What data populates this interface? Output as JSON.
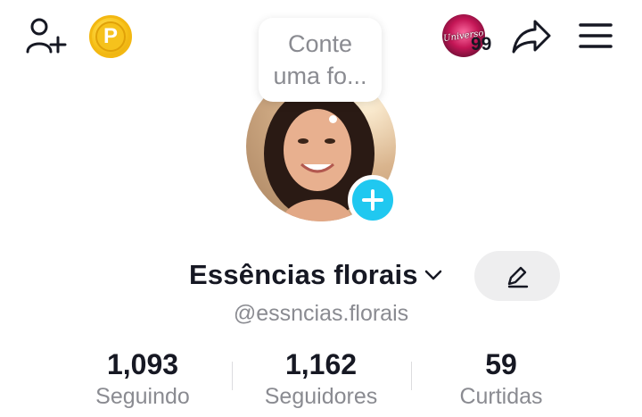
{
  "topbar": {
    "icons": [
      "add-friend-icon",
      "coin-icon",
      "story-thumbnail",
      "share-icon",
      "menu-icon"
    ],
    "coin_letter": "P",
    "story_thumb_text": "Universo",
    "story_count": "99"
  },
  "profile": {
    "bubble_text": "Conte uma fo...",
    "display_name": "Essências florais",
    "username": "@essncias.florais",
    "accent_color": "#20c8f0"
  },
  "stats": [
    {
      "value": "1,093",
      "label": "Seguindo"
    },
    {
      "value": "1,162",
      "label": "Seguidores"
    },
    {
      "value": "59",
      "label": "Curtidas"
    }
  ]
}
